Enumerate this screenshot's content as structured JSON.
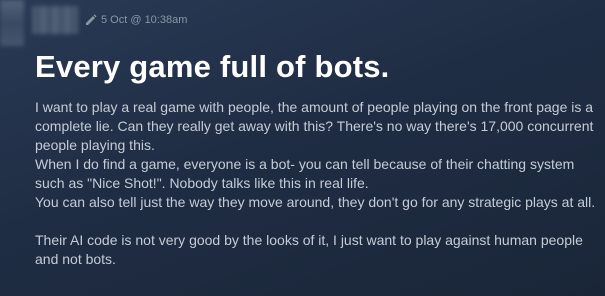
{
  "post": {
    "timestamp": "5 Oct @ 10:38am",
    "title": "Every game full of bots.",
    "body_lines": [
      "I want to play a real game with people, the amount of people playing on the front page is a",
      "complete lie. Can they really get away with this? There's no way there's 17,000 concurrent",
      "people playing this.",
      "When I do find a game, everyone is a bot- you can tell because of their chatting system",
      "such as \"Nice Shot!\". Nobody talks like this in real life.",
      "You can also tell just the way they move around, they don't go for any strategic plays at all.",
      "",
      "Their AI code is not very good by the looks of it, I just want to play against human people",
      "and not bots."
    ]
  },
  "icons": {
    "edited": "pen-icon"
  }
}
